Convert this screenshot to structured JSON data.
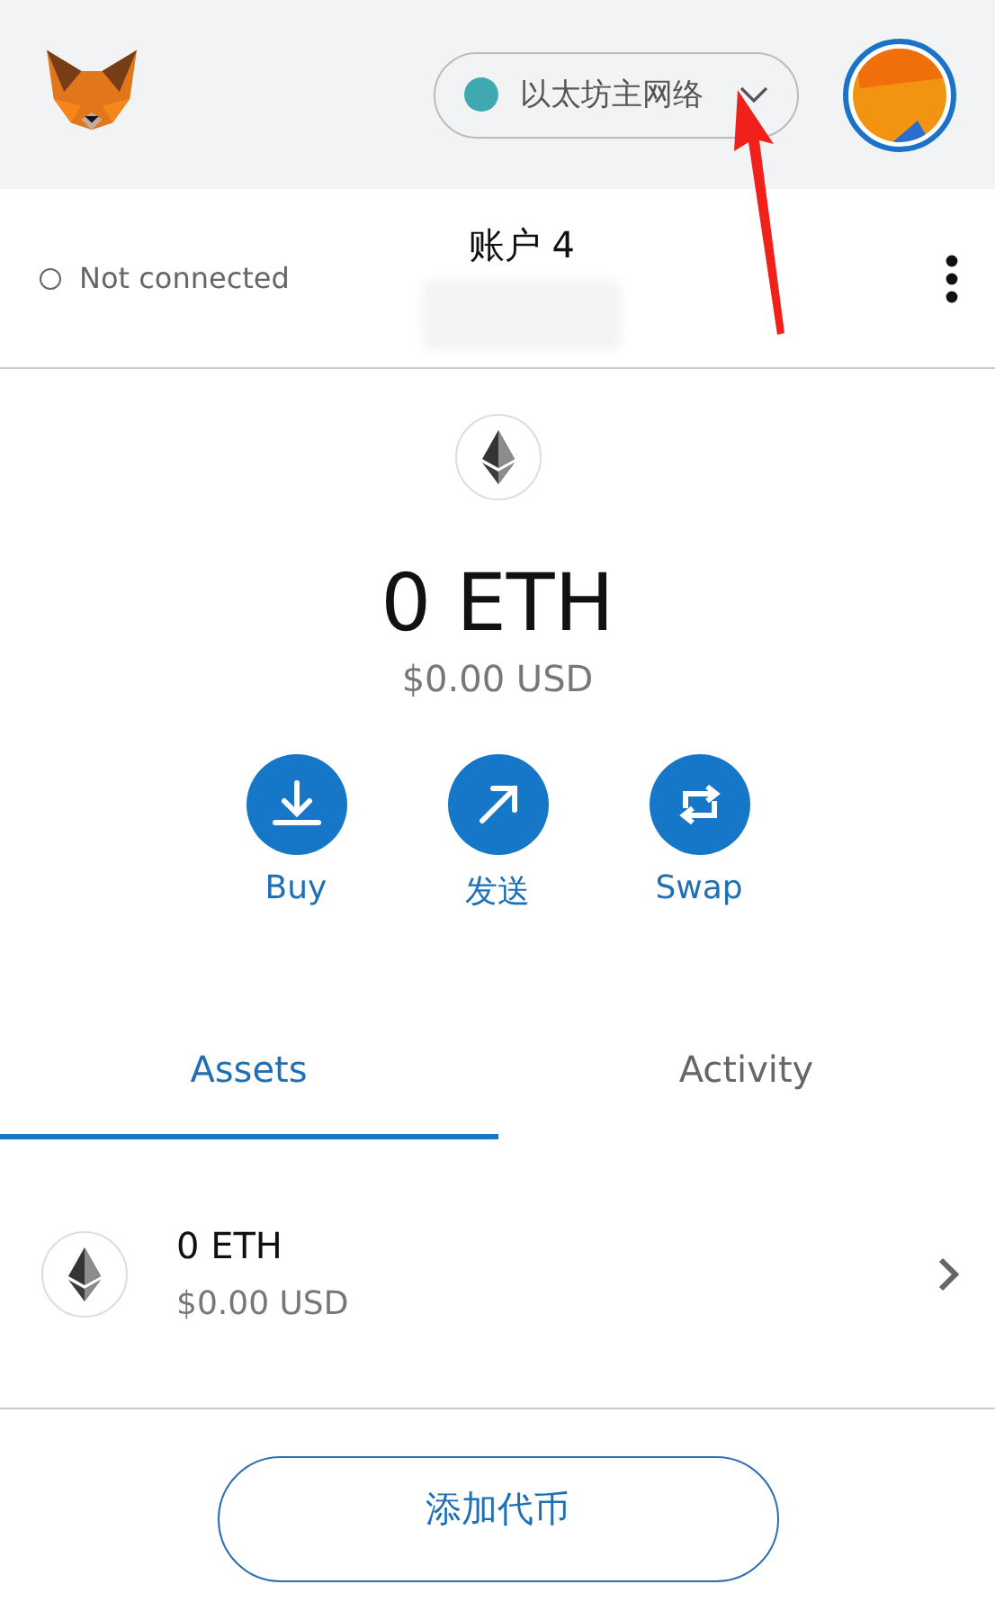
{
  "header": {
    "network": {
      "name": "以太坊主网络",
      "color": "#3fa8b0"
    }
  },
  "account": {
    "connection": "Not connected",
    "connected": false,
    "name": "账户 4"
  },
  "balance": {
    "amount": "0 ETH",
    "fiat": "$0.00 USD"
  },
  "actions": [
    {
      "kind": "buy",
      "label": "Buy"
    },
    {
      "kind": "send",
      "label": "发送"
    },
    {
      "kind": "swap",
      "label": "Swap"
    }
  ],
  "tabs": [
    {
      "label": "Assets",
      "selected": true
    },
    {
      "label": "Activity",
      "selected": false
    }
  ],
  "assets": [
    {
      "amount": "0 ETH",
      "fiat": "$0.00 USD"
    }
  ],
  "add_token_button": "添加代币"
}
